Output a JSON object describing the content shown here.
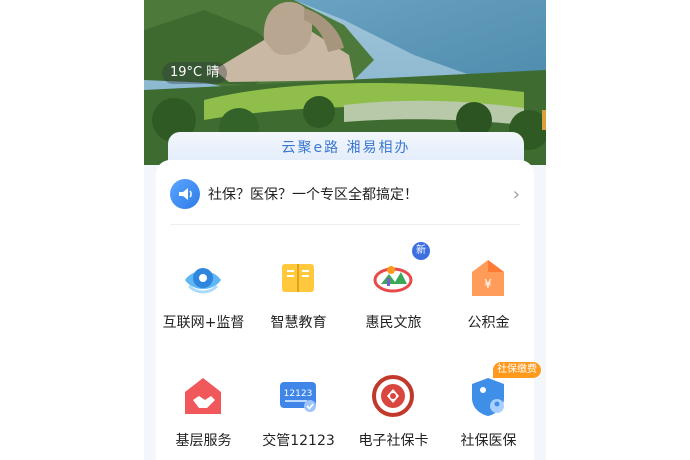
{
  "header": {
    "weather": "19°C 晴",
    "banner_slogan": "云聚e路 湘易相办"
  },
  "notice": {
    "text": "社保？医保？一个专区全都搞定！",
    "chevron": "›",
    "icon": "speaker-icon"
  },
  "services": [
    {
      "label": "互联网+监督",
      "icon": "eye-shield-icon",
      "badge": ""
    },
    {
      "label": "智慧教育",
      "icon": "book-icon",
      "badge": ""
    },
    {
      "label": "惠民文旅",
      "icon": "culture-tourism-icon",
      "badge": "新"
    },
    {
      "label": "公积金",
      "icon": "housing-fund-icon",
      "badge": ""
    },
    {
      "label": "基层服务",
      "icon": "handshake-house-icon",
      "badge": ""
    },
    {
      "label": "交管12123",
      "icon": "traffic-12123-icon",
      "badge": "",
      "icon_text": "12123"
    },
    {
      "label": "电子社保卡",
      "icon": "social-security-card-icon",
      "badge": ""
    },
    {
      "label": "社保医保",
      "icon": "medical-insurance-shield-icon",
      "badge": "社保缴费"
    }
  ],
  "colors": {
    "accent_blue": "#3b78cf",
    "badge_blue": "#3d6fe0",
    "badge_orange": "#ff9a1f"
  }
}
